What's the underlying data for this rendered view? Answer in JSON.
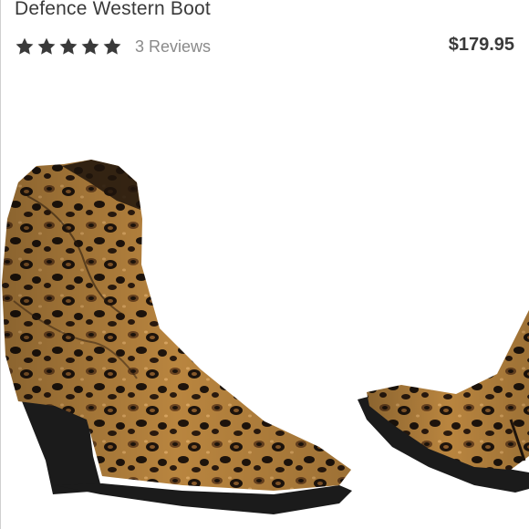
{
  "product": {
    "title": "Defence Western Boot",
    "rating_stars": 5,
    "reviews_label": "3 Reviews",
    "price": "$179.95"
  },
  "image": {
    "subject": "boot-image"
  },
  "colors": {
    "text": "#3a3a3a",
    "muted": "#8a8a8a",
    "star": "#3a3a3a",
    "leopard_base": "#b9853f",
    "leopard_spot": "#1e140c",
    "sole": "#1b1b1b"
  }
}
